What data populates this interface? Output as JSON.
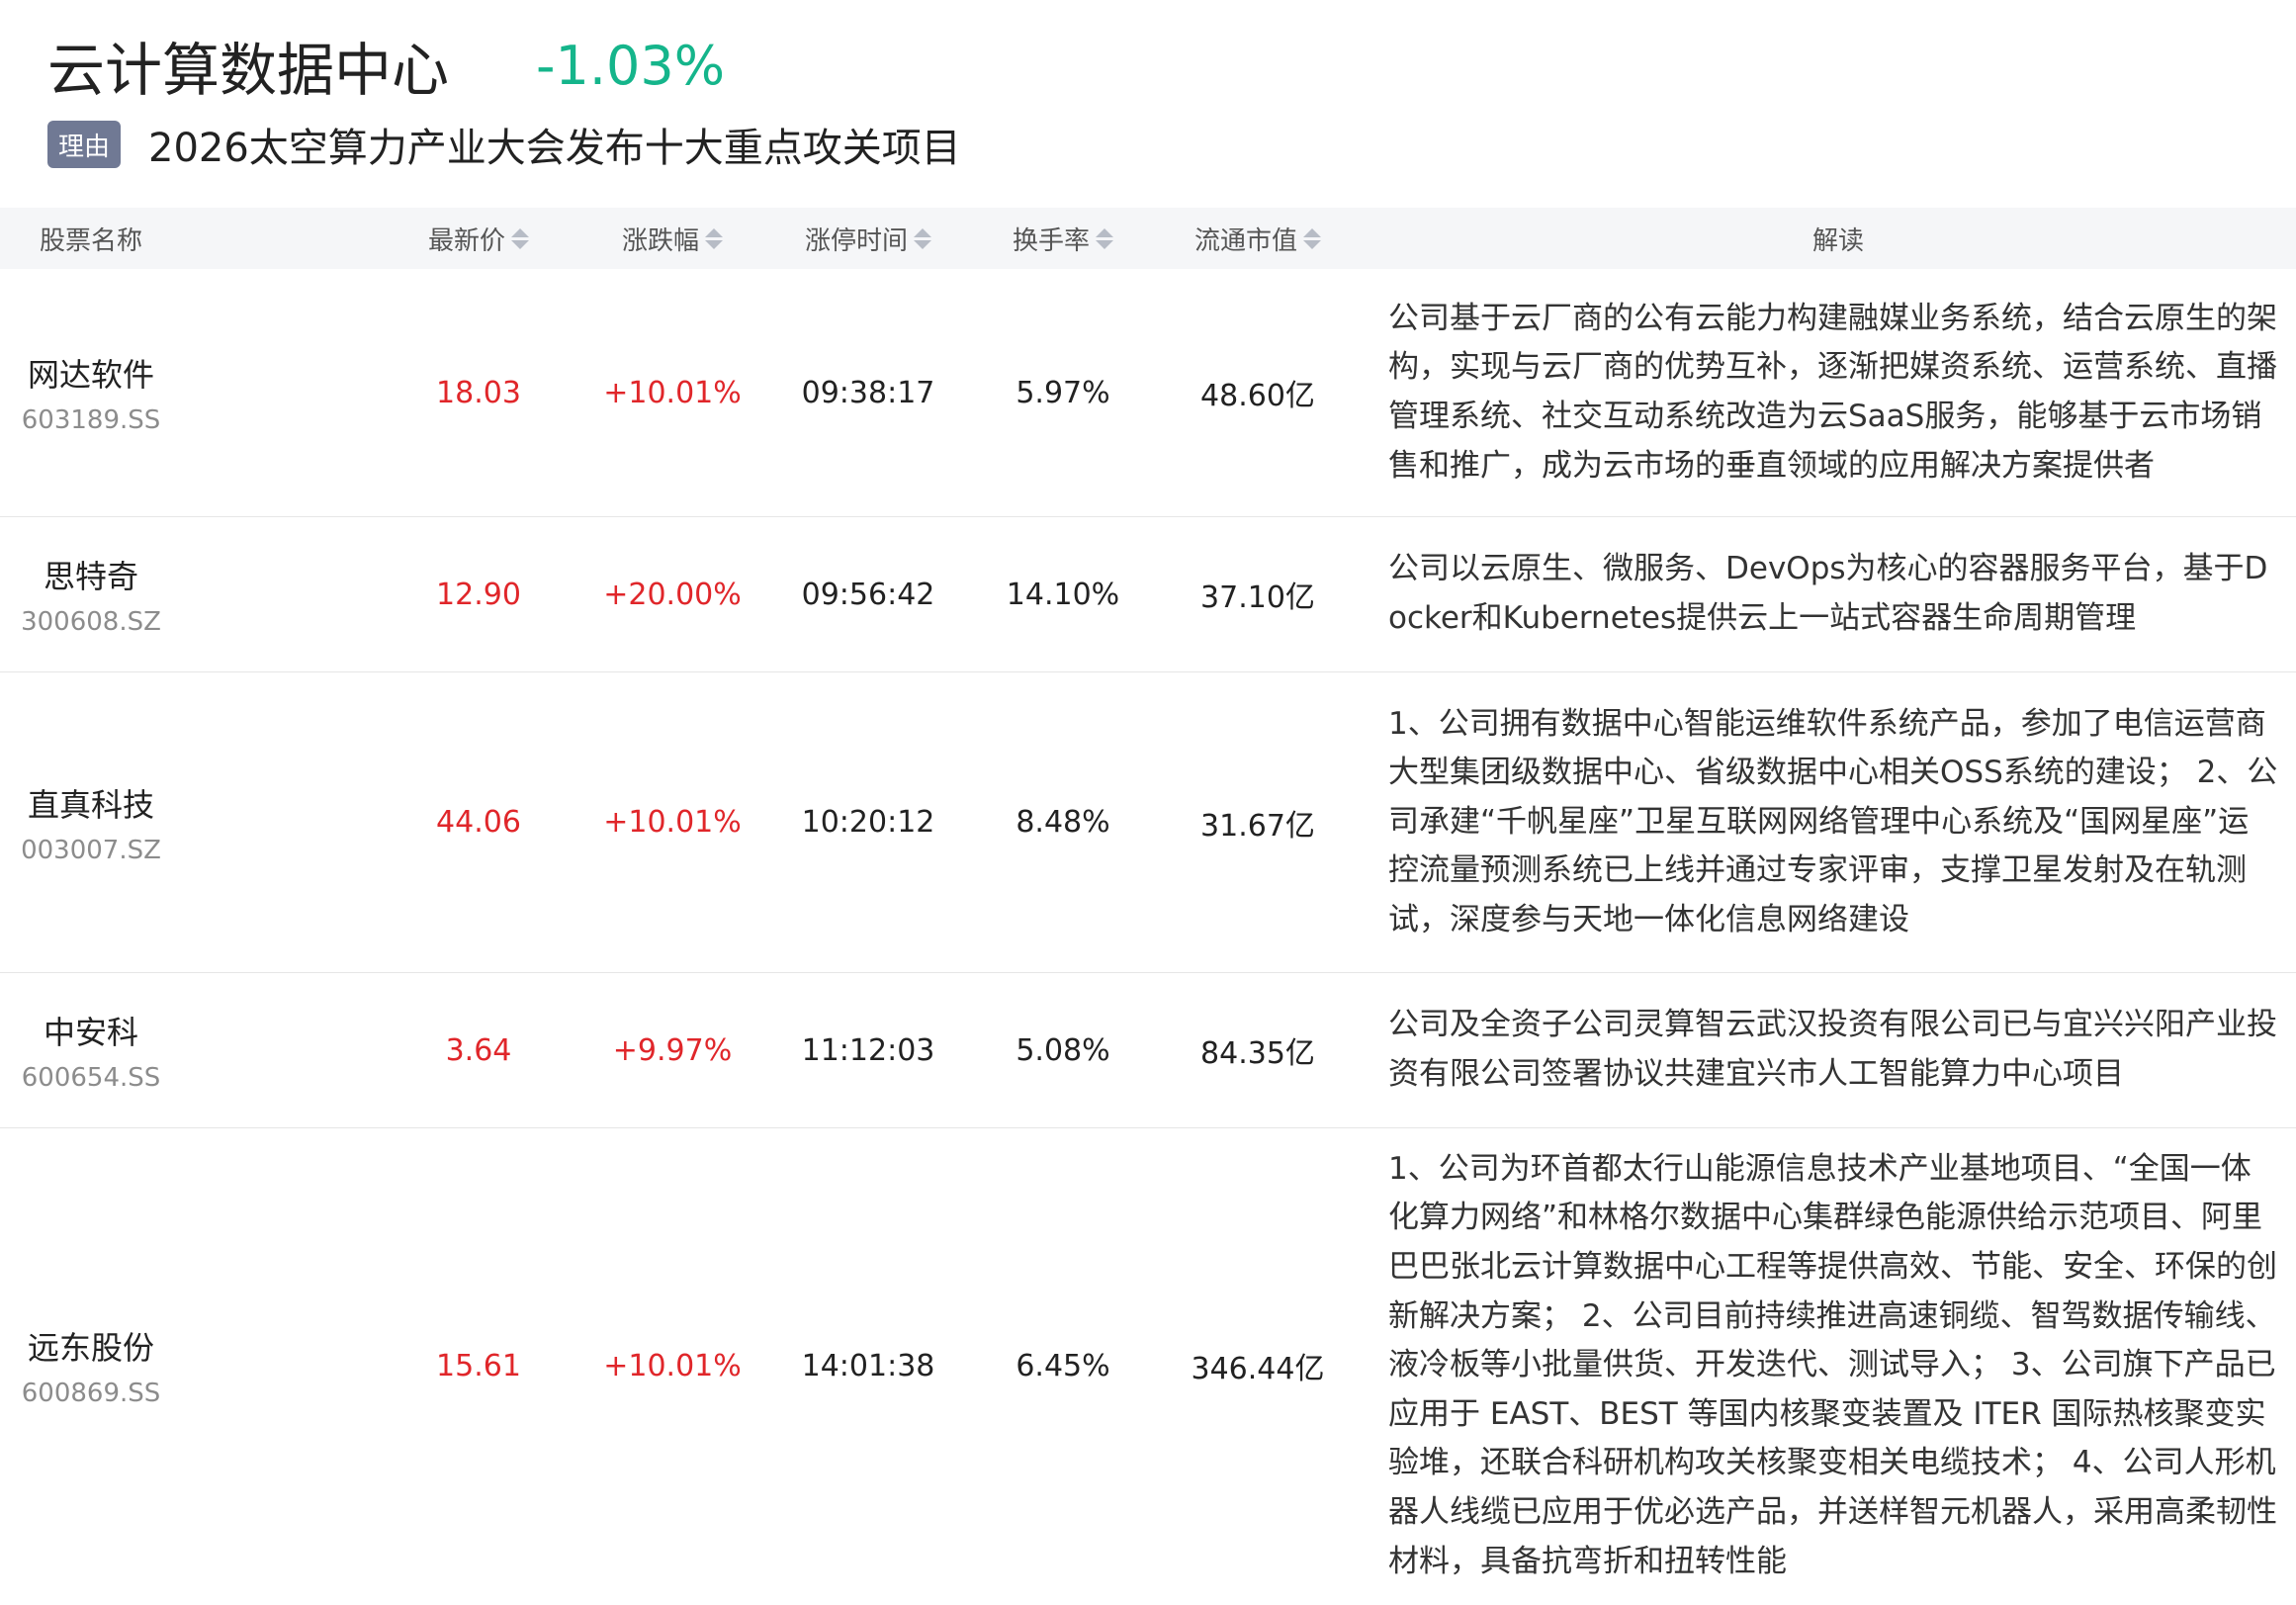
{
  "header": {
    "title": "云计算数据中心",
    "change": "-1.03%",
    "reason_tag": "理由",
    "reason_text": "2026太空算力产业大会发布十大重点攻关项目"
  },
  "columns": [
    {
      "label": "股票名称",
      "sortable": false
    },
    {
      "label": "最新价",
      "sortable": true
    },
    {
      "label": "涨跌幅",
      "sortable": true
    },
    {
      "label": "涨停时间",
      "sortable": true
    },
    {
      "label": "换手率",
      "sortable": true
    },
    {
      "label": "流通市值",
      "sortable": true
    },
    {
      "label": "解读",
      "sortable": false
    }
  ],
  "rows": [
    {
      "name": "网达软件",
      "code": "603189.SS",
      "price": "18.03",
      "pct": "+10.01%",
      "time": "09:38:17",
      "turnover": "5.97%",
      "mcap": "48.60亿",
      "desc": "公司基于云厂商的公有云能力构建融媒业务系统，结合云原生的架构，实现与云厂商的优势互补，逐渐把媒资系统、运营系统、直播管理系统、社交互动系统改造为云SaaS服务，能够基于云市场销售和推广，成为云市场的垂直领域的应用解决方案提供者"
    },
    {
      "name": "思特奇",
      "code": "300608.SZ",
      "price": "12.90",
      "pct": "+20.00%",
      "time": "09:56:42",
      "turnover": "14.10%",
      "mcap": "37.10亿",
      "desc": "公司以云原生、微服务、DevOps为核心的容器服务平台，基于Docker和Kubernetes提供云上一站式容器生命周期管理"
    },
    {
      "name": "直真科技",
      "code": "003007.SZ",
      "price": "44.06",
      "pct": "+10.01%",
      "time": "10:20:12",
      "turnover": "8.48%",
      "mcap": "31.67亿",
      "desc": "1、公司拥有数据中心智能运维软件系统产品，参加了电信运营商大型集团级数据中心、省级数据中心相关OSS系统的建设； 2、公司承建“千帆星座”卫星互联网网络管理中心系统及“国网星座”运控流量预测系统已上线并通过专家评审，支撑卫星发射及在轨测试，深度参与天地一体化信息网络建设"
    },
    {
      "name": "中安科",
      "code": "600654.SS",
      "price": "3.64",
      "pct": "+9.97%",
      "time": "11:12:03",
      "turnover": "5.08%",
      "mcap": "84.35亿",
      "desc": "公司及全资子公司灵算智云武汉投资有限公司已与宜兴兴阳产业投资有限公司签署协议共建宜兴市人工智能算力中心项目"
    },
    {
      "name": "远东股份",
      "code": "600869.SS",
      "price": "15.61",
      "pct": "+10.01%",
      "time": "14:01:38",
      "turnover": "6.45%",
      "mcap": "346.44亿",
      "desc": "1、公司为环首都太行山能源信息技术产业基地项目、“全国一体化算力网络”和林格尔数据中心集群绿色能源供给示范项目、阿里巴巴张北云计算数据中心工程等提供高效、节能、安全、环保的创新解决方案； 2、公司目前持续推进高速铜缆、智驾数据传输线、液冷板等小批量供货、开发迭代、测试导入； 3、公司旗下产品已应用于 EAST、BEST 等国内核聚变装置及 ITER 国际热核聚变实验堆，还联合科研机构攻关核聚变相关电缆技术； 4、公司人形机器人线缆已应用于优必选产品，并送样智元机器人，采用高柔韧性材料，具备抗弯折和扭转性能"
    }
  ],
  "colors": {
    "up": "#e0262a",
    "down": "#15b58b",
    "header_bg": "#f5f6f8",
    "tag_bg": "#707994"
  }
}
